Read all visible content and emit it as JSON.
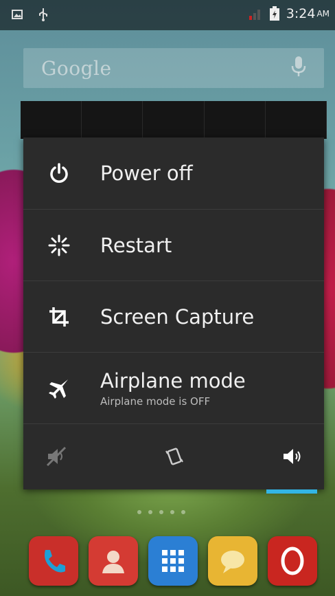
{
  "status_bar": {
    "time": "3:24",
    "ampm": "AM",
    "icons": [
      "gallery-notification-icon",
      "usb-icon",
      "signal-icon",
      "battery-icon"
    ]
  },
  "search": {
    "placeholder": "Google",
    "icon": "mic-icon"
  },
  "power_menu": {
    "items": [
      {
        "label": "Power off",
        "icon": "power-icon"
      },
      {
        "label": "Restart",
        "icon": "restart-icon"
      },
      {
        "label": "Screen Capture",
        "icon": "crop-icon"
      },
      {
        "label": "Airplane mode",
        "sublabel": "Airplane mode is OFF",
        "icon": "airplane-icon"
      }
    ],
    "sound_modes": [
      "silent-icon",
      "vibrate-icon",
      "sound-on-icon"
    ],
    "selected_sound_mode": "sound-on-icon",
    "accent_color": "#33b5e5"
  },
  "dock": {
    "apps": [
      {
        "name": "phone",
        "color": "#c92f2a"
      },
      {
        "name": "contacts",
        "color": "#d43b33"
      },
      {
        "name": "app-drawer",
        "color": "#2b7fd4"
      },
      {
        "name": "messaging",
        "color": "#e8b533"
      },
      {
        "name": "opera",
        "color": "#c92620"
      }
    ]
  }
}
